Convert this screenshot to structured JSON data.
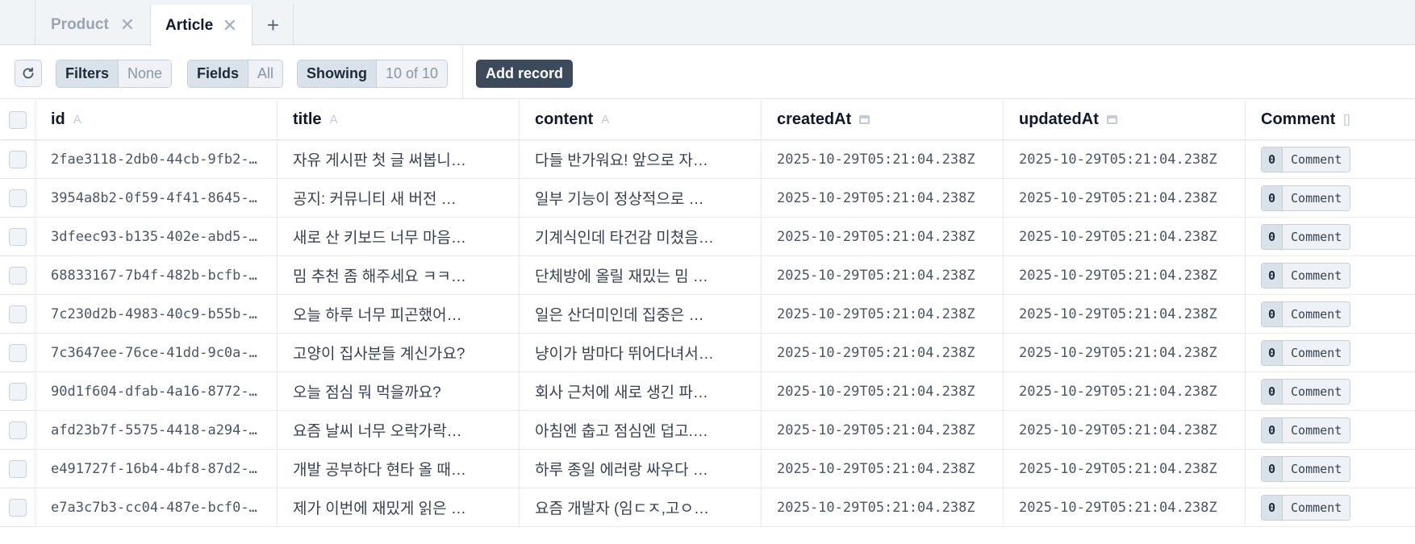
{
  "tabs": [
    {
      "label": "Product",
      "active": false
    },
    {
      "label": "Article",
      "active": true
    }
  ],
  "toolbar": {
    "filters_label": "Filters",
    "filters_value": "None",
    "fields_label": "Fields",
    "fields_value": "All",
    "showing_label": "Showing",
    "showing_value": "10 of 10",
    "add_record_label": "Add record"
  },
  "columns": [
    {
      "label": "id",
      "type_icon": "A"
    },
    {
      "label": "title",
      "type_icon": "A"
    },
    {
      "label": "content",
      "type_icon": "A"
    },
    {
      "label": "createdAt",
      "type_icon": "calendar-icon"
    },
    {
      "label": "updatedAt",
      "type_icon": "calendar-icon"
    },
    {
      "label": "Comment",
      "type_icon": "[]"
    }
  ],
  "rows": [
    {
      "id": "2fae3118-2db0-44cb-9fb2-…",
      "title": "자유 게시판 첫 글 써봅니…",
      "content": "다들 반가워요! 앞으로 자…",
      "createdAt": "2025-10-29T05:21:04.238Z",
      "updatedAt": "2025-10-29T05:21:04.238Z",
      "comment_count": "0",
      "comment_label": "Comment"
    },
    {
      "id": "3954a8b2-0f59-4f41-8645-…",
      "title": "공지: 커뮤니티 새 버전 …",
      "content": "일부 기능이 정상적으로 …",
      "createdAt": "2025-10-29T05:21:04.238Z",
      "updatedAt": "2025-10-29T05:21:04.238Z",
      "comment_count": "0",
      "comment_label": "Comment"
    },
    {
      "id": "3dfeec93-b135-402e-abd5-…",
      "title": "새로 산 키보드 너무 마음…",
      "content": "기계식인데 타건감 미쳤음…",
      "createdAt": "2025-10-29T05:21:04.238Z",
      "updatedAt": "2025-10-29T05:21:04.238Z",
      "comment_count": "0",
      "comment_label": "Comment"
    },
    {
      "id": "68833167-7b4f-482b-bcfb-…",
      "title": "밈 추천 좀 해주세요 ㅋㅋ…",
      "content": "단체방에 올릴 재밌는 밈 …",
      "createdAt": "2025-10-29T05:21:04.238Z",
      "updatedAt": "2025-10-29T05:21:04.238Z",
      "comment_count": "0",
      "comment_label": "Comment"
    },
    {
      "id": "7c230d2b-4983-40c9-b55b-…",
      "title": "오늘 하루 너무 피곤했어…",
      "content": "일은 산더미인데 집중은 …",
      "createdAt": "2025-10-29T05:21:04.238Z",
      "updatedAt": "2025-10-29T05:21:04.238Z",
      "comment_count": "0",
      "comment_label": "Comment"
    },
    {
      "id": "7c3647ee-76ce-41dd-9c0a-…",
      "title": "고양이 집사분들 계신가요?",
      "content": "냥이가 밤마다 뛰어다녀서…",
      "createdAt": "2025-10-29T05:21:04.238Z",
      "updatedAt": "2025-10-29T05:21:04.238Z",
      "comment_count": "0",
      "comment_label": "Comment"
    },
    {
      "id": "90d1f604-dfab-4a16-8772-…",
      "title": "오늘 점심 뭐 먹을까요?",
      "content": "회사 근처에 새로 생긴 파…",
      "createdAt": "2025-10-29T05:21:04.238Z",
      "updatedAt": "2025-10-29T05:21:04.238Z",
      "comment_count": "0",
      "comment_label": "Comment"
    },
    {
      "id": "afd23b7f-5575-4418-a294-…",
      "title": "요즘 날씨 너무 오락가락…",
      "content": "아침엔 춥고 점심엔 덥고.…",
      "createdAt": "2025-10-29T05:21:04.238Z",
      "updatedAt": "2025-10-29T05:21:04.238Z",
      "comment_count": "0",
      "comment_label": "Comment"
    },
    {
      "id": "e491727f-16b4-4bf8-87d2-…",
      "title": "개발 공부하다 현타 올 때…",
      "content": "하루 종일 에러랑 싸우다 …",
      "createdAt": "2025-10-29T05:21:04.238Z",
      "updatedAt": "2025-10-29T05:21:04.238Z",
      "comment_count": "0",
      "comment_label": "Comment"
    },
    {
      "id": "e7a3c7b3-cc04-487e-bcf0-…",
      "title": "제가 이번에 재밌게 읽은 …",
      "content": "요즘 개발자 (임ㄷㅈ,고ㅇ…",
      "createdAt": "2025-10-29T05:21:04.238Z",
      "updatedAt": "2025-10-29T05:21:04.238Z",
      "comment_count": "0",
      "comment_label": "Comment"
    }
  ]
}
